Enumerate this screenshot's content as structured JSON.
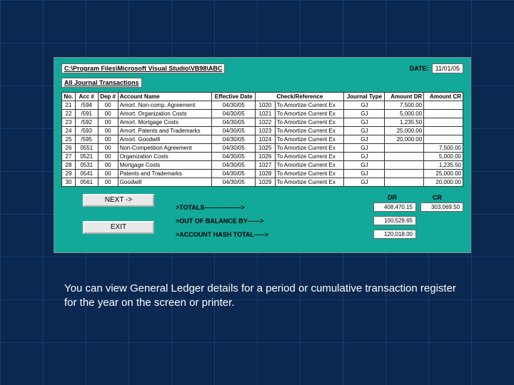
{
  "header": {
    "path": "C:\\Program Files\\Microsoft Visual Studio\\VB98\\ABC",
    "date_label": "DATE:",
    "date_value": "11/01/05",
    "subtitle": "All Journal Transactions"
  },
  "columns": {
    "no": "No.",
    "acc": "Acc #",
    "dep": "Dep #",
    "name": "Account Name",
    "edate": "Effective Date",
    "checkref": "Check/Reference",
    "jt": "Journal Type",
    "dr": "Amount DR",
    "cr": "Amount CR"
  },
  "rows": [
    {
      "no": "21",
      "acc": "/594",
      "dep": "00",
      "name": "Amort. Non-comp. Agreement",
      "edate": "04/30/05",
      "chk": "1020",
      "ref": "To Amortize Current Ex",
      "jt": "GJ",
      "dr": "7,500.00",
      "cr": ""
    },
    {
      "no": "22",
      "acc": "/591",
      "dep": "00",
      "name": "Amort. Organization Costs",
      "edate": "04/30/05",
      "chk": "1021",
      "ref": "To Amortize Current Ex",
      "jt": "GJ",
      "dr": "5,000.00",
      "cr": ""
    },
    {
      "no": "23",
      "acc": "/592",
      "dep": "00",
      "name": "Amort. Mortgage Costs",
      "edate": "04/30/05",
      "chk": "1022",
      "ref": "To Amortize Current Ex",
      "jt": "GJ",
      "dr": "1,235.50",
      "cr": ""
    },
    {
      "no": "24",
      "acc": "/593",
      "dep": "00",
      "name": "Amort. Patents and Trademarks",
      "edate": "04/30/05",
      "chk": "1023",
      "ref": "To Amortize Current Ex",
      "jt": "GJ",
      "dr": "25,000.00",
      "cr": ""
    },
    {
      "no": "25",
      "acc": "/595",
      "dep": "00",
      "name": "Amort. Goodwill",
      "edate": "04/30/05",
      "chk": "1024",
      "ref": "To Amortize Current Ex",
      "jt": "GJ",
      "dr": "20,000.00",
      "cr": ""
    },
    {
      "no": "26",
      "acc": "0551",
      "dep": "00",
      "name": "Non-Competition Agreement",
      "edate": "04/30/05",
      "chk": "1025",
      "ref": "To Amortize Current Ex",
      "jt": "GJ",
      "dr": "",
      "cr": "7,500.00"
    },
    {
      "no": "27",
      "acc": "0521",
      "dep": "00",
      "name": "Organization Costs",
      "edate": "04/30/05",
      "chk": "1026",
      "ref": "To Amortize Current Ex",
      "jt": "GJ",
      "dr": "",
      "cr": "5,000.00"
    },
    {
      "no": "28",
      "acc": "0531",
      "dep": "00",
      "name": "Mortgage Costs",
      "edate": "04/30/05",
      "chk": "1027",
      "ref": "To Amortize Current Ex",
      "jt": "GJ",
      "dr": "",
      "cr": "1,235.50"
    },
    {
      "no": "29",
      "acc": "0541",
      "dep": "00",
      "name": "Patents and Trademarks",
      "edate": "04/30/05",
      "chk": "1028",
      "ref": "To Amortize Current Ex",
      "jt": "GJ",
      "dr": "",
      "cr": "25,000.00"
    },
    {
      "no": "30",
      "acc": "0561",
      "dep": "00",
      "name": "Goodwill",
      "edate": "04/30/05",
      "chk": "1029",
      "ref": "To Amortize Current Ex",
      "jt": "GJ",
      "dr": "",
      "cr": "20,000.00"
    }
  ],
  "buttons": {
    "next": "NEXT ->",
    "exit": "EXIT"
  },
  "totals": {
    "hdr_dr": "DR",
    "hdr_cr": "CR",
    "totals_label": ">TOTALS----------------->",
    "totals_dr": "408,470.15",
    "totals_cr": "303,069.50",
    "oob_label": ">OUT OF BALANCE BY------>",
    "oob_val": "100,529.65",
    "hash_label": ">ACCOUNT HASH TOTAL----->",
    "hash_val": "120,018.00"
  },
  "caption": "You can view General Ledger details for a period or cumulative transaction register for the year on the screen or printer."
}
